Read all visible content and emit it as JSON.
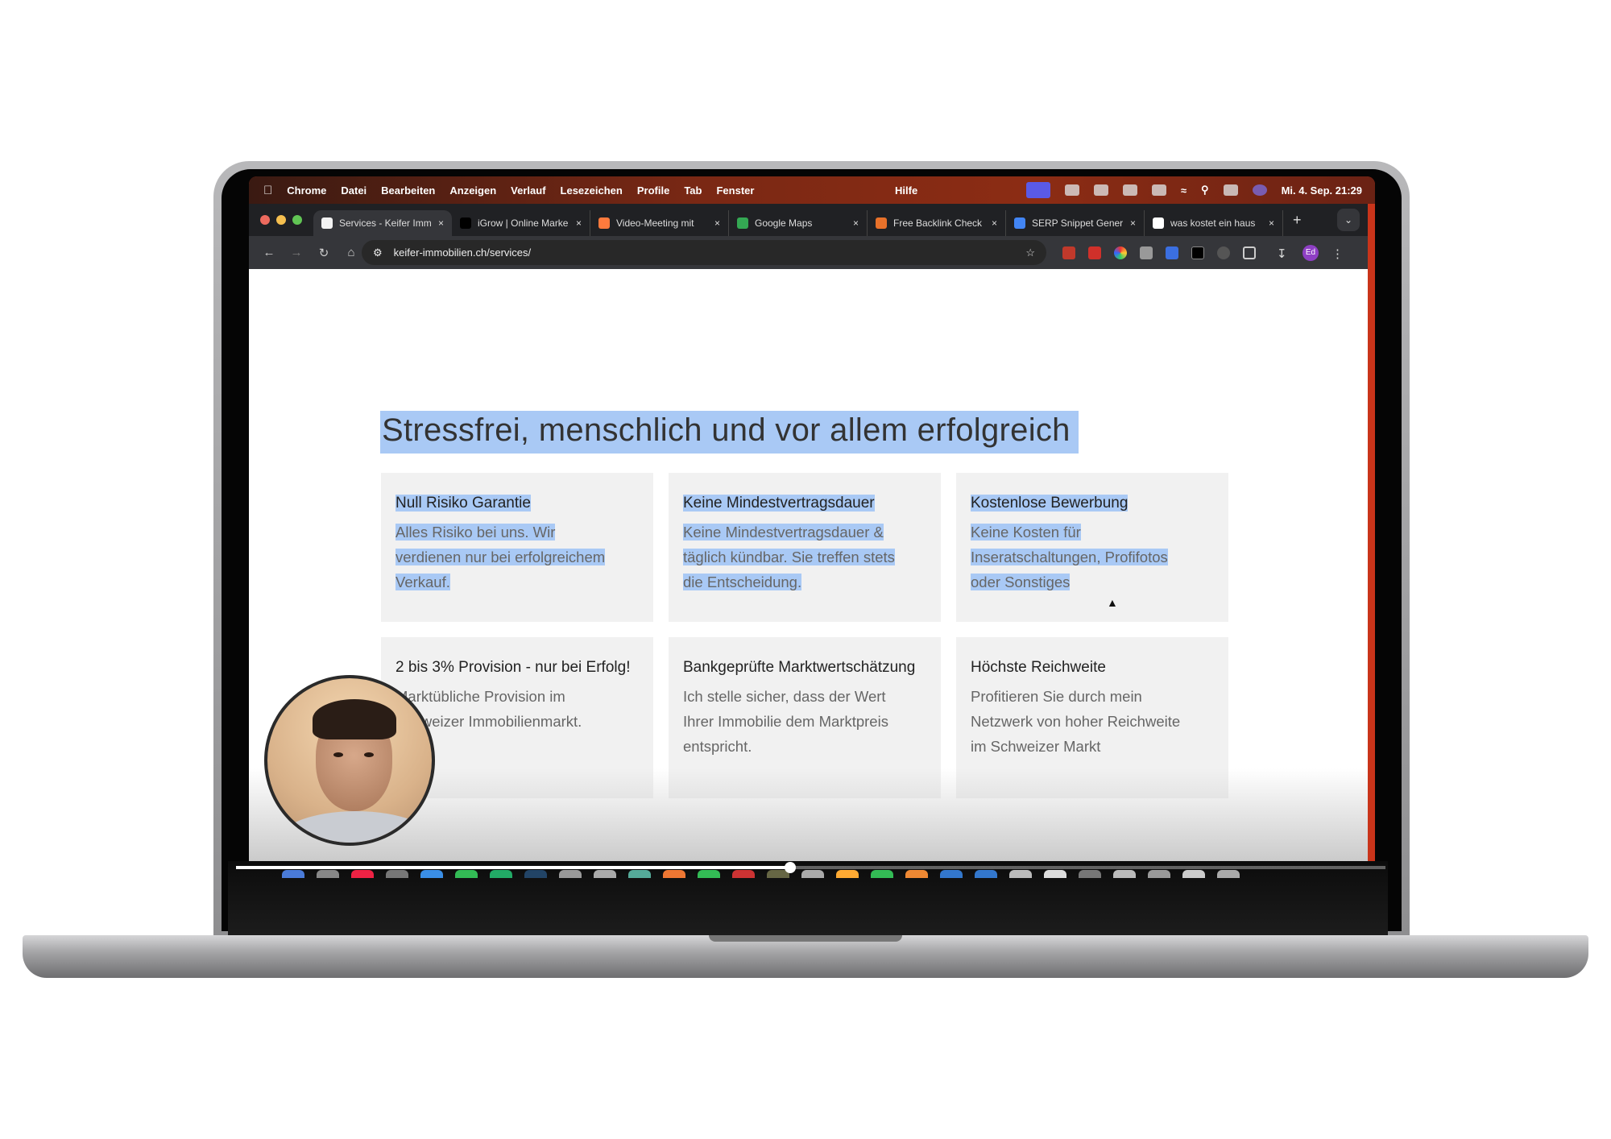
{
  "menubar": {
    "app": "Chrome",
    "items": [
      "Datei",
      "Bearbeiten",
      "Anzeigen",
      "Verlauf",
      "Lesezeichen",
      "Profile",
      "Tab",
      "Fenster"
    ],
    "help": "Hilfe",
    "datetime": "Mi. 4. Sep.  21:29"
  },
  "tabs": [
    {
      "title": "Services - Keifer Imm",
      "active": true
    },
    {
      "title": "iGrow | Online Marke"
    },
    {
      "title": "Video-Meeting mit"
    },
    {
      "title": "Google Maps"
    },
    {
      "title": "Free Backlink Check"
    },
    {
      "title": "SERP Snippet Gener"
    },
    {
      "title": "was kostet ein haus"
    }
  ],
  "toolbar": {
    "url": "keifer-immobilien.ch/services/",
    "profile": "Ed"
  },
  "page": {
    "heading": "Stressfrei, menschlich und vor allem erfolgreich",
    "cards": [
      {
        "title": "Null Risiko Garantie",
        "lines": [
          "Alles Risiko bei uns. Wir",
          "verdienen nur bei erfolgreichem",
          "Verkauf."
        ]
      },
      {
        "title": "Keine Mindestvertragsdauer",
        "lines": [
          "Keine Mindestvertragsdauer &",
          "täglich kündbar. Sie treffen stets",
          "die Entscheidung."
        ]
      },
      {
        "title": "Kostenlose Bewerbung",
        "lines": [
          "Keine Kosten für",
          "Inseratschaltungen, Profifotos",
          "oder Sonstiges"
        ]
      },
      {
        "title": "2 bis 3% Provision - nur bei Erfolg!",
        "lines": [
          "Marktübliche Provision im",
          "Schweizer Immobilienmarkt."
        ]
      },
      {
        "title": "Bankgeprüfte Marktwertschätzung",
        "lines": [
          "Ich stelle sicher, dass der Wert",
          "Ihrer Immobilie dem Marktpreis",
          "entspricht."
        ]
      },
      {
        "title": "Höchste Reichweite",
        "lines": [
          "Profitieren Sie durch mein",
          "Netzwerk von hoher Reichweite",
          "im Schweizer Markt"
        ]
      }
    ]
  },
  "video": {
    "progress_fraction": 0.482
  },
  "colors": {
    "selection": "#a9c9f5",
    "card_bg": "#f1f1f1",
    "menubar": "#8c2c14"
  }
}
